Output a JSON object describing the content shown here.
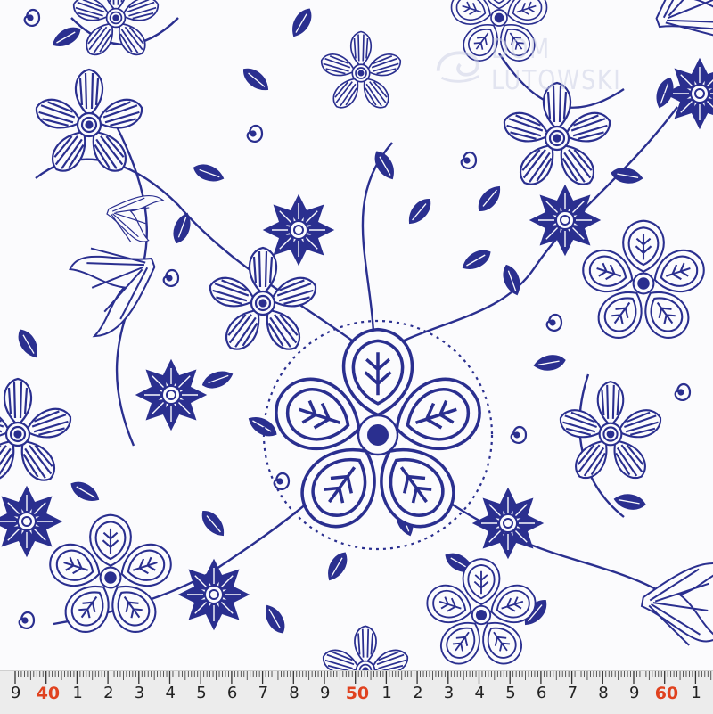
{
  "colors": {
    "ink": "#2a2f8f",
    "fabric": "#fbfbfd",
    "ruler_bg": "#ececec",
    "ruler_accent": "#e0421f"
  },
  "watermark": {
    "text": "DOM LUTOWSKI",
    "logo": "swirl-logo-icon"
  },
  "ruler": {
    "labels": [
      "9",
      "40",
      "1",
      "2",
      "3",
      "4",
      "5",
      "6",
      "7",
      "8",
      "9",
      "50",
      "1",
      "2",
      "3",
      "4",
      "5",
      "6",
      "7",
      "8",
      "9",
      "60",
      "1"
    ]
  },
  "pattern": {
    "motif_icons": [
      "big-center-flower-icon",
      "striped-flower-icon",
      "star-flower-icon",
      "paisley-flower-icon",
      "bell-flower-icon",
      "leaf-icon",
      "swirl-icon"
    ]
  }
}
